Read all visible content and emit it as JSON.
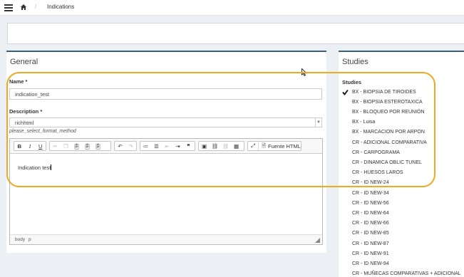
{
  "breadcrumb": {
    "current": "Indications",
    "separator": "/"
  },
  "general": {
    "title": "General",
    "name_label": "Name *",
    "name_value": "indication_test",
    "description_label": "Description *",
    "format_value": "richhtml",
    "format_hint": "please_select_format_method",
    "editor": {
      "source_label": "Fuente HTML",
      "content": "Indication test",
      "status_path": [
        "body",
        "p"
      ]
    }
  },
  "studies": {
    "title": "Studies",
    "list_label": "Studies",
    "items": [
      {
        "label": "BX - BIOPSIA DE TIROIDES",
        "checked": true
      },
      {
        "label": "BX - BIOPSIA ESTEROTAXICA",
        "checked": false
      },
      {
        "label": "BX - BLOQUEO POR REUNIÓN",
        "checked": false
      },
      {
        "label": "BX - Luisa",
        "checked": false
      },
      {
        "label": "BX - MARCACION POR ARPON",
        "checked": false
      },
      {
        "label": "CR - ADICIONAL COMPARATIVA",
        "checked": false
      },
      {
        "label": "CR - CARPOGRAMA",
        "checked": false
      },
      {
        "label": "CR - DINAMICA OBLIC TUNEL",
        "checked": false
      },
      {
        "label": "CR - HUESOS LAROS",
        "checked": false
      },
      {
        "label": "CR - ID NEW-24",
        "checked": false
      },
      {
        "label": "CR - ID NEW-34",
        "checked": false
      },
      {
        "label": "CR - ID NEW-56",
        "checked": false
      },
      {
        "label": "CR - ID NEW-64",
        "checked": false
      },
      {
        "label": "CR - ID NEW-66",
        "checked": false
      },
      {
        "label": "CR - ID NEW-85",
        "checked": false
      },
      {
        "label": "CR - ID NEW-87",
        "checked": false
      },
      {
        "label": "CR - ID NEW-91",
        "checked": false
      },
      {
        "label": "CR - ID NEW-94",
        "checked": false
      },
      {
        "label": "CR - MUÑECAS COMPARATIVAS + ADICIONAL",
        "checked": false
      }
    ]
  },
  "colors": {
    "panel_border": "#3c5d7d",
    "highlight": "#f0a81e",
    "background": "#ecf0f5"
  }
}
